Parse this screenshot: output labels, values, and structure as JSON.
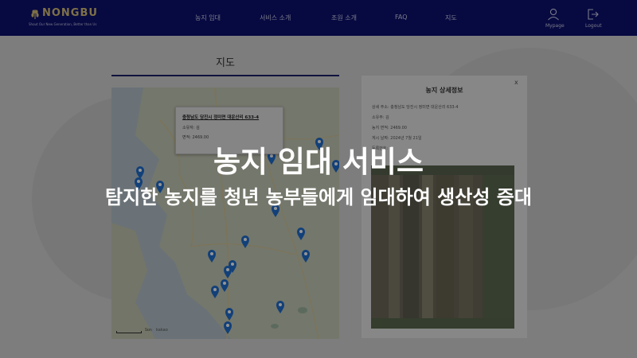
{
  "brand": {
    "name": "NONGBU",
    "slogan": "Shout Our New Generation, Better than Us"
  },
  "nav": {
    "items": [
      "농지 임대",
      "서비스 소개",
      "조원 소개",
      "FAQ",
      "지도"
    ],
    "mypage_label": "Mypage",
    "logout_label": "Logout"
  },
  "page": {
    "title": "지도"
  },
  "map": {
    "popup": {
      "address": "충청남도 당진시 정미면 대운산리 633-4",
      "owner": "소유자: 김",
      "area": "면적: 2469.00"
    },
    "scale_label": "5km",
    "provider": "kakao"
  },
  "detail": {
    "title": "농지 상세정보",
    "close_label": "x",
    "lines": [
      "상세 주소: 충청남도 당진시 정미면 대운산리 633-4",
      "소유주: 김",
      "농지 면적: 2469.00",
      "게시 날짜: 2024년 7월 21일",
      "등록번호: 1"
    ]
  },
  "overlay": {
    "title": "농지 임대 서비스",
    "subtitle": "탐지한 농지를 청년 농부들에게 임대하여 생산성 증대"
  },
  "colors": {
    "navbar": "#0d1170",
    "marker": "#1f6fd1",
    "accent": "#1b1f6b"
  }
}
